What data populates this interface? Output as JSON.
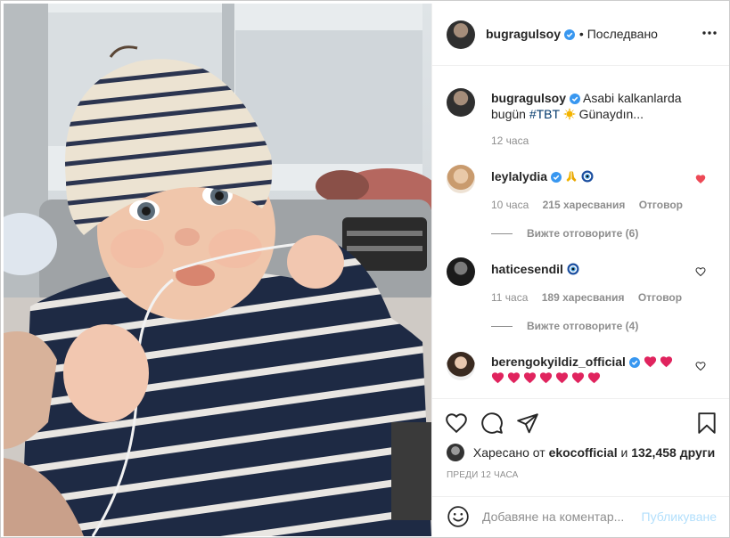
{
  "post": {
    "owner": "bugragulsoy",
    "follow_status": "Последвано",
    "caption_part1": "Asabi kalkanlarda",
    "caption_part2": "bugün",
    "caption_tag": "#TBT",
    "caption_part3": "Günaydın...",
    "caption_time": "12 часа"
  },
  "comments": [
    {
      "user": "leylalydia",
      "time": "10 часа",
      "likes": "215 харесвания",
      "reply": "Отговор",
      "replies_label": "Вижте отговорите (6)",
      "liked": true
    },
    {
      "user": "haticesendil",
      "time": "11 часа",
      "likes": "189 харесвания",
      "reply": "Отговор",
      "replies_label": "Вижте отговорите (4)",
      "liked": false
    },
    {
      "user": "berengokyildiz_official",
      "liked": false
    }
  ],
  "likes_summary": {
    "prefix": "Харесано от",
    "first_user": "ekocofficial",
    "middle": "и",
    "count": "132,458 други"
  },
  "posted_ago": "ПРЕДИ 12 ЧАСА",
  "comment_box": {
    "placeholder": "Добавяне на коментар...",
    "post_label": "Публикуване"
  },
  "colors": {
    "verified": "#3897f0",
    "liked_heart": "#ed4956",
    "link": "#00376b",
    "muted": "#8e8e8e",
    "post_disabled": "#b2dffc"
  },
  "icons": [
    "more-icon",
    "verified-icon",
    "heart-icon",
    "comment-icon",
    "share-icon",
    "bookmark-icon",
    "smiley-icon",
    "pray-emoji",
    "nazar-emoji",
    "sun-emoji",
    "red-heart-emoji"
  ]
}
